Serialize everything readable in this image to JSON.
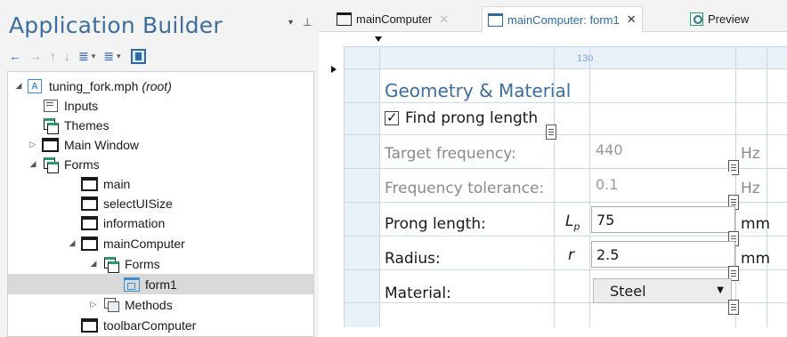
{
  "app": {
    "title": "Application Builder",
    "menu_glyph": "▾",
    "pin_glyph": "⊥"
  },
  "toolbar": {
    "back_glyph": "←",
    "forward_glyph": "→",
    "up_glyph": "↑",
    "down_glyph": "↓",
    "move_up_glyph": "≣",
    "move_down_glyph": "≣",
    "dropdown_glyph": "▾"
  },
  "tree": {
    "root_label": "tuning_fork.mph",
    "root_suffix": "(root)",
    "root_icon_letter": "A",
    "items": [
      {
        "label": "Inputs"
      },
      {
        "label": "Themes"
      },
      {
        "label": "Main Window"
      },
      {
        "label": "Forms"
      },
      {
        "label": "main"
      },
      {
        "label": "selectUISize"
      },
      {
        "label": "information"
      },
      {
        "label": "mainComputer"
      },
      {
        "label": "Forms"
      },
      {
        "label": "form1"
      },
      {
        "label": "Methods"
      },
      {
        "label": "toolbarComputer"
      }
    ],
    "expand_open": "◢",
    "expand_closed": "▷"
  },
  "tabs": [
    {
      "label": "mainComputer",
      "close": "✕"
    },
    {
      "label": "mainComputer: form1",
      "close": "✕"
    },
    {
      "label": "Preview"
    }
  ],
  "grid": {
    "column_width_label": "130"
  },
  "form": {
    "title": "Geometry & Material",
    "checkbox_label": "Find prong length",
    "target_frequency": {
      "label": "Target frequency:",
      "value": "440",
      "unit": "Hz"
    },
    "frequency_tolerance": {
      "label": "Frequency tolerance:",
      "value": "0.1",
      "unit": "Hz"
    },
    "prong_length": {
      "label": "Prong length:",
      "symbol": "L",
      "symbol_sub": "p",
      "value": "75",
      "unit": "mm"
    },
    "radius": {
      "label": "Radius:",
      "symbol": "r",
      "value": "2.5",
      "unit": "mm"
    },
    "material": {
      "label": "Material:",
      "value": "Steel",
      "arrow": "▼"
    }
  }
}
